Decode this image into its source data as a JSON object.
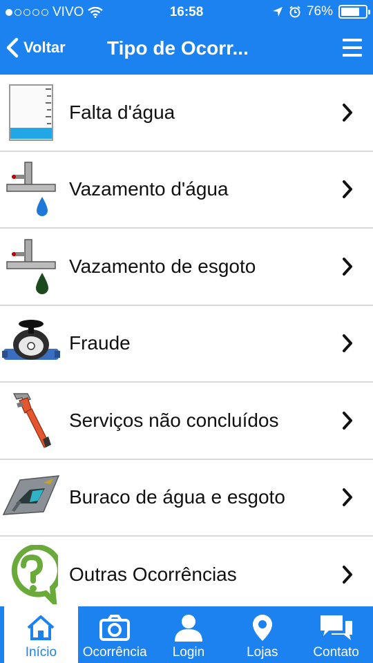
{
  "status_bar": {
    "carrier": "VIVO",
    "time": "16:58",
    "battery_percent": "76%",
    "battery_level": 0.76
  },
  "nav": {
    "back_label": "Voltar",
    "title": "Tipo de Ocorr..."
  },
  "list": {
    "items": [
      {
        "label": "Falta d'água",
        "icon": "water-tank-icon"
      },
      {
        "label": "Vazamento d'água",
        "icon": "pipe-water-leak-icon"
      },
      {
        "label": "Vazamento de esgoto",
        "icon": "pipe-sewage-leak-icon"
      },
      {
        "label": "Fraude",
        "icon": "water-meter-icon"
      },
      {
        "label": "Serviços não concluídos",
        "icon": "pipe-wrench-icon"
      },
      {
        "label": "Buraco de água e esgoto",
        "icon": "road-hole-icon"
      },
      {
        "label": "Outras Ocorrências",
        "icon": "question-mark-icon"
      }
    ]
  },
  "tabbar": {
    "tabs": [
      {
        "label": "Início",
        "icon": "home-icon",
        "active": true
      },
      {
        "label": "Ocorrência",
        "icon": "camera-icon",
        "active": false
      },
      {
        "label": "Login",
        "icon": "user-icon",
        "active": false
      },
      {
        "label": "Lojas",
        "icon": "location-pin-icon",
        "active": false
      },
      {
        "label": "Contato",
        "icon": "chat-bubbles-icon",
        "active": false
      }
    ]
  },
  "colors": {
    "accent": "#1b82f0",
    "text": "#111111",
    "divider": "#d9d9d9"
  }
}
